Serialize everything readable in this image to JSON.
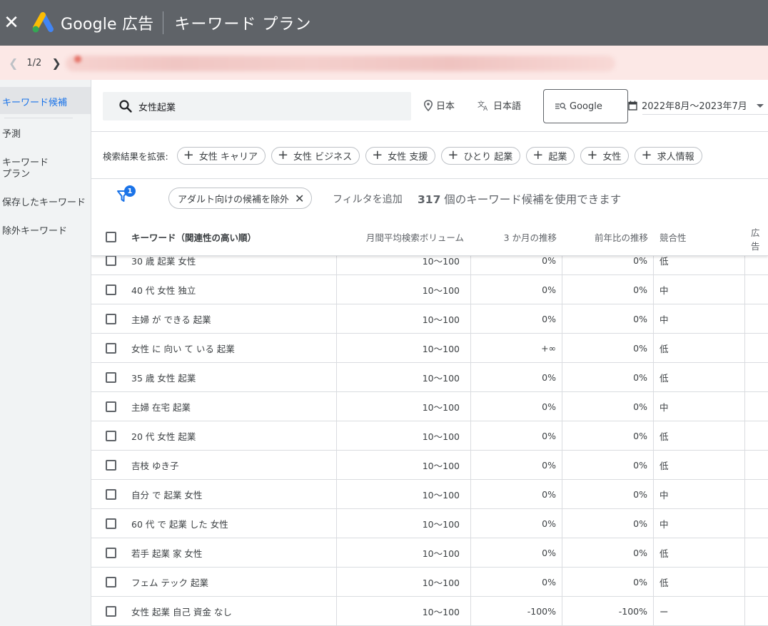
{
  "app": {
    "close_label": "✕",
    "brand": "Google 広告",
    "page_title": "キーワード プラン"
  },
  "notice": {
    "pager": "1/2"
  },
  "sidebar": {
    "items": [
      {
        "label": "キーワード候補"
      },
      {
        "label": "予測"
      },
      {
        "label": "キーワード\nプラン"
      },
      {
        "label": "保存したキーワード"
      },
      {
        "label": "除外キーワード"
      }
    ]
  },
  "search": {
    "value": "女性起業",
    "location": "日本",
    "language": "日本語",
    "network": "Google",
    "date_range": "2022年8月～2023年7月"
  },
  "expand": {
    "label": "検索結果を拡張:",
    "chips": [
      "女性 キャリア",
      "女性 ビジネス",
      "女性 支援",
      "ひとり 起業",
      "起業",
      "女性",
      "求人情報"
    ]
  },
  "filters": {
    "badge_count": "1",
    "active_filter": "アダルト向けの候補を除外",
    "add_filter": "フィルタを追加",
    "count": "317",
    "count_suffix": " 個のキーワード候補を使用できます"
  },
  "table": {
    "headers": {
      "keyword": "キーワード（関連性の高い順）",
      "volume": "月間平均検索ボリューム",
      "three_month": "3 か月の推移",
      "yoy": "前年比の推移",
      "competition": "競合性",
      "ad": "広告"
    },
    "rows": [
      {
        "keyword": "30 歳 起業 女性",
        "volume": "10～100",
        "three_month": "0%",
        "yoy": "0%",
        "competition": "低"
      },
      {
        "keyword": "40 代 女性 独立",
        "volume": "10～100",
        "three_month": "0%",
        "yoy": "0%",
        "competition": "中"
      },
      {
        "keyword": "主婦 が できる 起業",
        "volume": "10～100",
        "three_month": "0%",
        "yoy": "0%",
        "competition": "中"
      },
      {
        "keyword": "女性 に 向い て いる 起業",
        "volume": "10～100",
        "three_month": "+∞",
        "yoy": "0%",
        "competition": "低"
      },
      {
        "keyword": "35 歳 女性 起業",
        "volume": "10～100",
        "three_month": "0%",
        "yoy": "0%",
        "competition": "低"
      },
      {
        "keyword": "主婦 在宅 起業",
        "volume": "10～100",
        "three_month": "0%",
        "yoy": "0%",
        "competition": "中"
      },
      {
        "keyword": "20 代 女性 起業",
        "volume": "10～100",
        "three_month": "0%",
        "yoy": "0%",
        "competition": "低"
      },
      {
        "keyword": "吉枝 ゆき子",
        "volume": "10～100",
        "three_month": "0%",
        "yoy": "0%",
        "competition": "低"
      },
      {
        "keyword": "自分 で 起業 女性",
        "volume": "10～100",
        "three_month": "0%",
        "yoy": "0%",
        "competition": "中"
      },
      {
        "keyword": "60 代 で 起業 した 女性",
        "volume": "10～100",
        "three_month": "0%",
        "yoy": "0%",
        "competition": "中"
      },
      {
        "keyword": "若手 起業 家 女性",
        "volume": "10～100",
        "three_month": "0%",
        "yoy": "0%",
        "competition": "低"
      },
      {
        "keyword": "フェム テック 起業",
        "volume": "10～100",
        "three_month": "0%",
        "yoy": "0%",
        "competition": "低"
      },
      {
        "keyword": "女性 起業 自己 資金 なし",
        "volume": "10～100",
        "three_month": "-100%",
        "yoy": "-100%",
        "competition": "ー"
      }
    ]
  },
  "colors": {
    "topbar": "#5f6368",
    "notice_bg": "#fce8e6",
    "accent": "#1a73e8"
  }
}
